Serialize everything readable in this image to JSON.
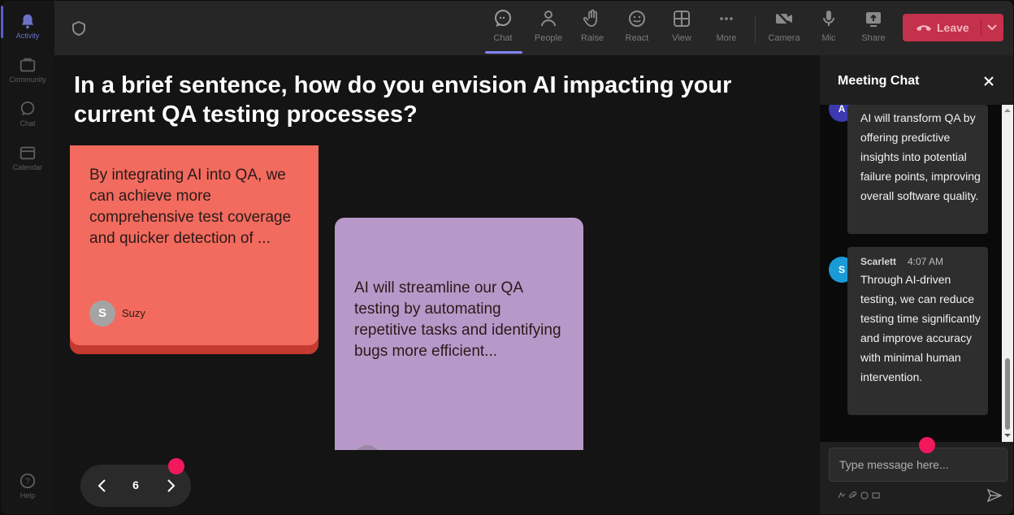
{
  "rail": {
    "items": [
      {
        "label": "Activity",
        "icon": "bell-icon"
      },
      {
        "label": "Community",
        "icon": "community-icon"
      },
      {
        "label": "Chat",
        "icon": "chat-icon"
      },
      {
        "label": "Calendar",
        "icon": "calendar-icon"
      },
      {
        "label": "Help",
        "icon": "help-icon"
      }
    ]
  },
  "toolbar": {
    "buttons": [
      {
        "label": "Chat",
        "icon": "chat-icon"
      },
      {
        "label": "People",
        "icon": "people-icon"
      },
      {
        "label": "Raise",
        "icon": "raise-hand-icon"
      },
      {
        "label": "React",
        "icon": "smiley-icon"
      },
      {
        "label": "View",
        "icon": "grid-icon"
      },
      {
        "label": "More",
        "icon": "more-icon"
      },
      {
        "label": "Camera",
        "icon": "camera-off-icon"
      },
      {
        "label": "Mic",
        "icon": "mic-icon"
      },
      {
        "label": "Share",
        "icon": "share-icon"
      }
    ],
    "leave_label": "Leave",
    "leave_color": "#c4314b"
  },
  "main": {
    "question": "In a brief sentence, how do you envision AI impacting your current QA testing processes?",
    "cards": [
      {
        "text": "By integrating AI into QA, we can achieve more comprehensive test coverage and quicker detection of ...",
        "author": "Suzy",
        "initial": "S",
        "color": "#f26b5e"
      },
      {
        "text": "AI will streamline our QA testing by automating repetitive tasks and identifying bugs more efficient...",
        "color": "#b898c8"
      }
    ],
    "page_number": "6",
    "accent_dot": "#f2185e"
  },
  "chat": {
    "title": "Meeting Chat",
    "messages": [
      {
        "initial": "A",
        "text": "AI will transform QA by offering predictive insights into potential failure points, improving overall software quality."
      },
      {
        "initial": "S",
        "sender": "Scarlett",
        "time": "4:07 AM",
        "text": "Through AI-driven testing, we can reduce testing time significantly and improve accuracy with minimal human intervention."
      }
    ],
    "input_placeholder": "Type message here..."
  }
}
